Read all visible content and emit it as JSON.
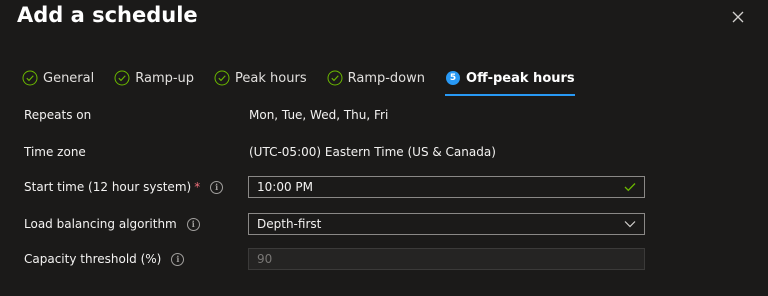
{
  "panel": {
    "title": "Add a schedule",
    "close_icon": "close-icon"
  },
  "tabs": [
    {
      "label": "General",
      "icon": "check-circle-icon",
      "state": "complete"
    },
    {
      "label": "Ramp-up",
      "icon": "check-circle-icon",
      "state": "complete"
    },
    {
      "label": "Peak hours",
      "icon": "check-circle-icon",
      "state": "complete"
    },
    {
      "label": "Ramp-down",
      "icon": "check-circle-icon",
      "state": "complete"
    },
    {
      "label": "Off-peak hours",
      "step_number": "5",
      "state": "active"
    }
  ],
  "form": {
    "repeats_on": {
      "label": "Repeats on",
      "value": "Mon, Tue, Wed, Thu, Fri"
    },
    "time_zone": {
      "label": "Time zone",
      "value": "(UTC-05:00) Eastern Time (US & Canada)"
    },
    "start_time": {
      "label": "Start time (12 hour system)",
      "required_mark": "*",
      "value": "10:00 PM"
    },
    "load_balancing": {
      "label": "Load balancing algorithm",
      "value": "Depth-first"
    },
    "capacity_threshold": {
      "label": "Capacity threshold (%)",
      "value": "90"
    }
  },
  "colors": {
    "background": "#1b1a19",
    "accent": "#2899f5",
    "success": "#6bb700",
    "required": "#f1707b"
  }
}
